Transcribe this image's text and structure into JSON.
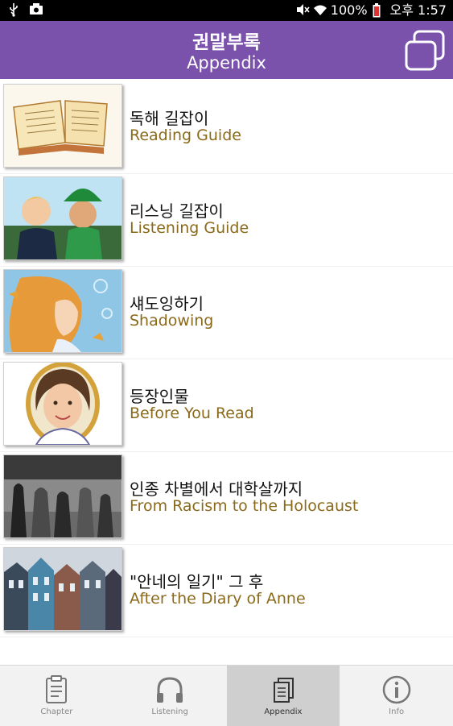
{
  "status_bar": {
    "battery": "100%",
    "time": "오후 1:57"
  },
  "header": {
    "title_ko": "권말부록",
    "title_en": "Appendix"
  },
  "items": [
    {
      "ko": "독해 길잡이",
      "en": "Reading Guide"
    },
    {
      "ko": "리스닝 길잡이",
      "en": "Listening Guide"
    },
    {
      "ko": "섀도잉하기",
      "en": "Shadowing"
    },
    {
      "ko": "등장인물",
      "en": "Before You Read"
    },
    {
      "ko": "인종 차별에서 대학살까지",
      "en": "From Racism to the Holocaust"
    },
    {
      "ko": "\"안네의 일기\" 그 후",
      "en": "After the Diary of Anne"
    }
  ],
  "tabs": [
    {
      "label": "Chapter",
      "icon": "clipboard-icon"
    },
    {
      "label": "Listening",
      "icon": "headphones-icon"
    },
    {
      "label": "Appendix",
      "icon": "pages-icon",
      "active": true
    },
    {
      "label": "Info",
      "icon": "info-icon"
    }
  ],
  "colors": {
    "header": "#7b52ab",
    "subtitle": "#8a6a1a"
  }
}
